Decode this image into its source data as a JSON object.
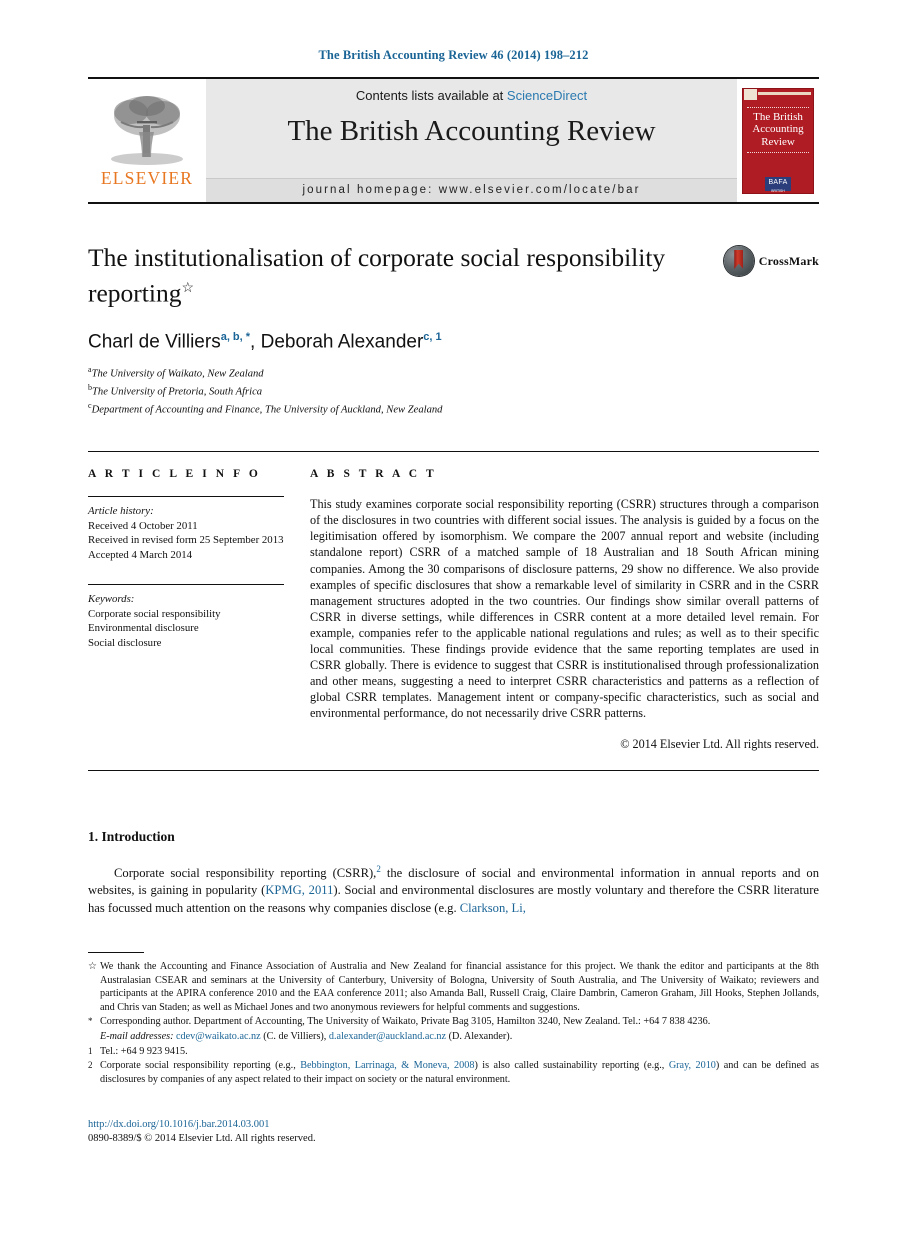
{
  "running_head": "The British Accounting Review 46 (2014) 198–212",
  "masthead": {
    "contents_prefix": "Contents lists available at ",
    "sciencedirect": "ScienceDirect",
    "journal_name": "The British Accounting Review",
    "homepage": "journal homepage: www.elsevier.com/locate/bar",
    "publisher_wordmark": "ELSEVIER",
    "cover_title": "The British Accounting Review",
    "cover_badge": "BAFA",
    "cover_badge_sub": "BRITISH ACCOUNTING ASSOCIATION"
  },
  "article": {
    "title": "The institutionalisation of corporate social responsibility reporting",
    "title_footnote_mark": "☆",
    "crossmark_label": "CrossMark",
    "authors": [
      {
        "name": "Charl de Villiers",
        "sups": "a, b, *"
      },
      {
        "name": "Deborah Alexander",
        "sups": "c, 1"
      }
    ],
    "authors_line_separator": ", ",
    "affiliations": [
      {
        "mark": "a",
        "text": "The University of Waikato, New Zealand"
      },
      {
        "mark": "b",
        "text": "The University of Pretoria, South Africa"
      },
      {
        "mark": "c",
        "text": "Department of Accounting and Finance, The University of Auckland, New Zealand"
      }
    ]
  },
  "article_info": {
    "heading": "A R T I C L E   I N F O",
    "history_label": "Article history:",
    "history": [
      "Received 4 October 2011",
      "Received in revised form 25 September 2013",
      "Accepted 4 March 2014"
    ],
    "keywords_label": "Keywords:",
    "keywords": [
      "Corporate social responsibility",
      "Environmental disclosure",
      "Social disclosure"
    ]
  },
  "abstract": {
    "heading": "A B S T R A C T",
    "text": "This study examines corporate social responsibility reporting (CSRR) structures through a comparison of the disclosures in two countries with different social issues. The analysis is guided by a focus on the legitimisation offered by isomorphism. We compare the 2007 annual report and website (including standalone report) CSRR of a matched sample of 18 Australian and 18 South African mining companies. Among the 30 comparisons of disclosure patterns, 29 show no difference. We also provide examples of specific disclosures that show a remarkable level of similarity in CSRR and in the CSRR management structures adopted in the two countries. Our findings show similar overall patterns of CSRR in diverse settings, while differences in CSRR content at a more detailed level remain. For example, companies refer to the applicable national regulations and rules; as well as to their specific local communities. These findings provide evidence that the same reporting templates are used in CSRR globally. There is evidence to suggest that CSRR is institutionalised through professionalization and other means, suggesting a need to interpret CSRR characteristics and patterns as a reflection of global CSRR templates. Management intent or company-specific characteristics, such as social and environmental performance, do not necessarily drive CSRR patterns.",
    "copyright": "© 2014 Elsevier Ltd. All rights reserved."
  },
  "introduction": {
    "heading": "1.  Introduction",
    "para_part1": "Corporate social responsibility reporting (CSRR),",
    "para_fn_mark": "2",
    "para_part2": " the disclosure of social and environmental information in annual reports and on websites, is gaining in popularity (",
    "cite_kpmg": "KPMG, 2011",
    "para_part3": "). Social and environmental disclosures are mostly voluntary and therefore the CSRR literature has focussed much attention on the reasons why companies disclose (e.g. ",
    "cite_clarkson": "Clarkson, Li,"
  },
  "footnotes": [
    {
      "mark": "☆",
      "text": "We thank the Accounting and Finance Association of Australia and New Zealand for financial assistance for this project. We thank the editor and participants at the 8th Australasian CSEAR and seminars at the University of Canterbury, University of Bologna, University of South Australia, and The University of Waikato; reviewers and participants at the APIRA conference 2010 and the EAA conference 2011; also Amanda Ball, Russell Craig, Claire Dambrin, Cameron Graham, Jill Hooks, Stephen Jollands, and Chris van Staden; as well as Michael Jones and two anonymous reviewers for helpful comments and suggestions."
    },
    {
      "mark": "*",
      "text": "Corresponding author. Department of Accounting, The University of Waikato, Private Bag 3105, Hamilton 3240, New Zealand. Tel.: +64 7 838 4236."
    },
    {
      "mark": "",
      "email_label": "E-mail addresses:",
      "email1": "cdev@waikato.ac.nz",
      "email1_who": " (C. de Villiers), ",
      "email2": "d.alexander@auckland.ac.nz",
      "email2_who": " (D. Alexander)."
    },
    {
      "mark": "1",
      "text": "Tel.: +64 9 923 9415."
    },
    {
      "mark": "2",
      "text_part1": "Corporate social responsibility reporting (e.g., ",
      "cite1": "Bebbington, Larrinaga, & Moneva, 2008",
      "text_part2": ") is also called sustainability reporting (e.g., ",
      "cite2": "Gray, 2010",
      "text_part3": ") and can be defined as disclosures by companies of any aspect related to their impact on society or the natural environment."
    }
  ],
  "doi": "http://dx.doi.org/10.1016/j.bar.2014.03.001",
  "issn_line": "0890-8389/$ © 2014 Elsevier Ltd. All rights reserved.",
  "colors": {
    "link_blue": "#1a6496",
    "sciencedirect_blue": "#2a7ab0",
    "elsevier_orange": "#E87722",
    "cover_red": "#b01c24"
  }
}
